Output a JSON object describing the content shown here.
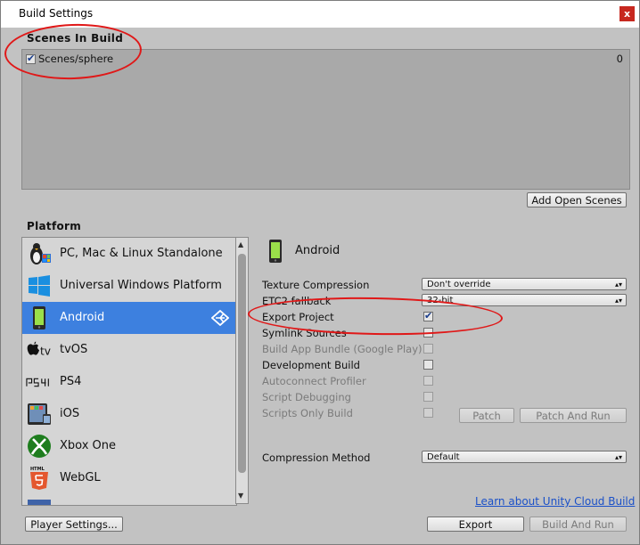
{
  "window": {
    "title": "Build Settings",
    "close_label": "x"
  },
  "scenes": {
    "header": "Scenes In Build",
    "items": [
      {
        "name": "Scenes/sphere",
        "index": "0",
        "checked": true
      }
    ],
    "add_open_scenes": "Add Open Scenes"
  },
  "platform": {
    "header": "Platform",
    "items": [
      {
        "label": "PC, Mac & Linux Standalone",
        "icon": "pc-penguin-icon"
      },
      {
        "label": "Universal Windows Platform",
        "icon": "windows-logo-icon"
      },
      {
        "label": "Android",
        "icon": "android-phone-icon",
        "selected": true
      },
      {
        "label": "tvOS",
        "icon": "apple-tv-icon"
      },
      {
        "label": "PS4",
        "icon": "ps4-logo-icon"
      },
      {
        "label": "iOS",
        "icon": "ipad-icon"
      },
      {
        "label": "Xbox One",
        "icon": "xbox-logo-icon"
      },
      {
        "label": "WebGL",
        "icon": "html5-logo-icon"
      }
    ]
  },
  "settings": {
    "platform_title": "Android",
    "texture_compression": {
      "label": "Texture Compression",
      "value": "Don't override"
    },
    "etc2_fallback": {
      "label": "ETC2 fallback",
      "value": "32-bit"
    },
    "export_project": {
      "label": "Export Project",
      "checked": true
    },
    "symlink_sources": {
      "label": "Symlink Sources",
      "checked": false
    },
    "build_app_bundle": {
      "label": "Build App Bundle (Google Play)",
      "checked": false
    },
    "development_build": {
      "label": "Development Build",
      "checked": false
    },
    "autoconnect_profiler": {
      "label": "Autoconnect Profiler",
      "checked": false
    },
    "script_debugging": {
      "label": "Script Debugging",
      "checked": false
    },
    "scripts_only_build": {
      "label": "Scripts Only Build",
      "checked": false
    },
    "patch": "Patch",
    "patch_and_run": "Patch And Run",
    "compression_method": {
      "label": "Compression Method",
      "value": "Default"
    },
    "cloud_build_link": "Learn about Unity Cloud Build"
  },
  "footer": {
    "player_settings": "Player Settings...",
    "export": "Export",
    "build_and_run": "Build And Run"
  },
  "colors": {
    "selection": "#3d80df",
    "annotation": "#e01818",
    "link": "#1a50c8"
  }
}
